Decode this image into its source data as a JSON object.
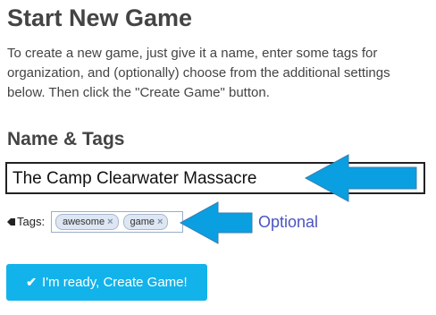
{
  "page": {
    "title": "Start New Game",
    "intro": "To create a new game, just give it a name, enter some tags for organization, and (optionally) choose from the additional settings below. Then click the \"Create Game\" button."
  },
  "section": {
    "title": "Name & Tags"
  },
  "name_field": {
    "value": "The Camp Clearwater Massacre",
    "icon": "contact-card-icon"
  },
  "tags": {
    "label": "Tags:",
    "icon": "tag-icon",
    "items": [
      {
        "label": "awesome",
        "remove": "×"
      },
      {
        "label": "game",
        "remove": "×"
      }
    ]
  },
  "annotation": {
    "optional_label": "Optional",
    "arrow_color": "#0a9fe0"
  },
  "create_button": {
    "label": "I'm ready, Create Game!",
    "icon": "check-icon",
    "color": "#12b3ea"
  }
}
